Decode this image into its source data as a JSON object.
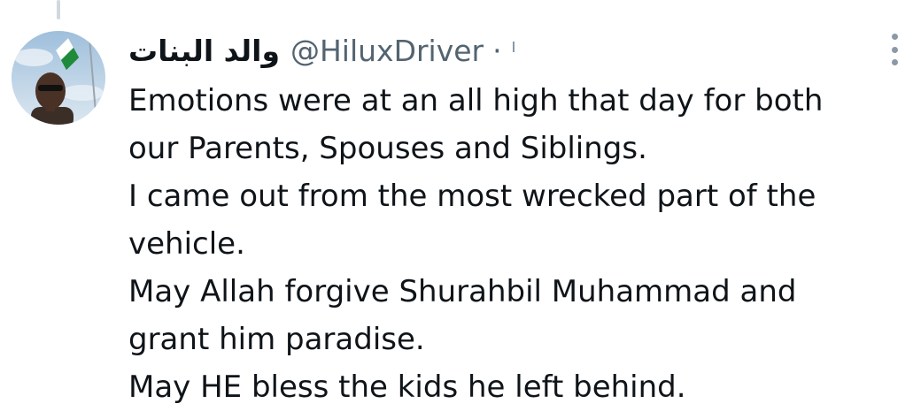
{
  "tweet": {
    "display_name": "والد البنات",
    "handle": "@HiluxDriver",
    "separator": "·",
    "lines": [
      "Emotions were at an all high that day for both",
      "our Parents, Spouses and Siblings.",
      "I came out from the most wrecked part of the",
      "vehicle.",
      "May Allah forgive Shurahbil Muhammad and",
      "grant him paradise.",
      "May HE bless the kids he left behind."
    ]
  },
  "icons": {
    "more": "more-vertical-icon",
    "avatar": "profile-photo"
  },
  "colors": {
    "text": "#0f1419",
    "secondary": "#536471",
    "icon": "#8b98a5",
    "thread_line": "#cfd9de"
  }
}
